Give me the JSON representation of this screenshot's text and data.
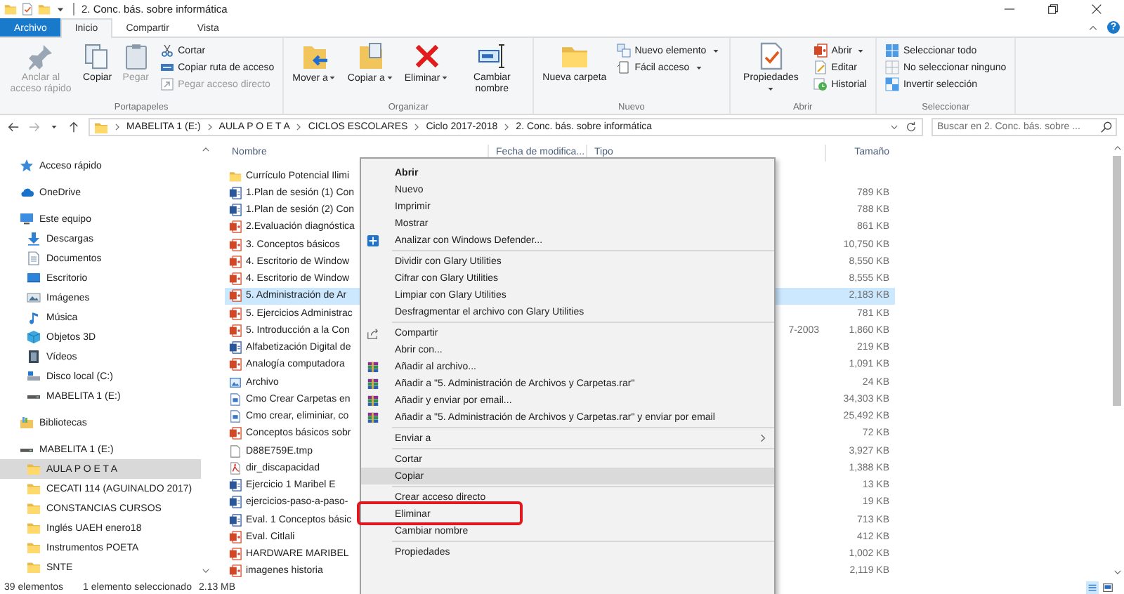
{
  "window": {
    "title": "2. Conc. bás. sobre informática",
    "help": "?"
  },
  "ribbon_tabs": [
    {
      "label": "Archivo",
      "kind": "file",
      "selected": false
    },
    {
      "label": "Inicio",
      "kind": "tab",
      "selected": true
    },
    {
      "label": "Compartir",
      "kind": "tab",
      "selected": false
    },
    {
      "label": "Vista",
      "kind": "tab",
      "selected": false
    }
  ],
  "ribbon_groups": [
    {
      "label": "Portapapeles",
      "large": [
        {
          "label": "Anclar al acceso rápido",
          "kind": "pin",
          "disabled": true,
          "dropdown": false
        },
        {
          "label": "Copiar",
          "kind": "copy",
          "disabled": false,
          "dropdown": false
        },
        {
          "label": "Pegar",
          "kind": "paste",
          "disabled": true,
          "dropdown": false
        }
      ],
      "small": [
        {
          "label": "Cortar",
          "kind": "cut",
          "disabled": false,
          "dropdown": false
        },
        {
          "label": "Copiar ruta de acceso",
          "kind": "path",
          "disabled": false,
          "dropdown": false
        },
        {
          "label": "Pegar acceso directo",
          "kind": "shortcut",
          "disabled": true,
          "dropdown": false
        }
      ]
    },
    {
      "label": "Organizar",
      "large": [
        {
          "label": "Mover a",
          "kind": "move",
          "disabled": false,
          "dropdown": true
        },
        {
          "label": "Copiar a",
          "kind": "copyto",
          "disabled": false,
          "dropdown": true
        },
        {
          "label": "Eliminar",
          "kind": "delete",
          "disabled": false,
          "dropdown": true
        },
        {
          "label": "Cambiar nombre",
          "kind": "rename",
          "disabled": false,
          "dropdown": false
        }
      ]
    },
    {
      "label": "Nuevo",
      "large": [
        {
          "label": "Nueva carpeta",
          "kind": "folder",
          "disabled": false,
          "dropdown": false
        }
      ],
      "small": [
        {
          "label": "Nuevo elemento",
          "kind": "newitem",
          "disabled": false,
          "dropdown": true
        },
        {
          "label": "Fácil acceso",
          "kind": "easy",
          "disabled": false,
          "dropdown": true
        }
      ]
    },
    {
      "label": "Abrir",
      "large": [
        {
          "label": "Propiedades",
          "kind": "properties",
          "disabled": false,
          "dropdown": true
        }
      ],
      "small": [
        {
          "label": "Abrir",
          "kind": "powerpoint",
          "disabled": false,
          "dropdown": true
        },
        {
          "label": "Editar",
          "kind": "edit",
          "disabled": false,
          "dropdown": false
        },
        {
          "label": "Historial",
          "kind": "history",
          "disabled": false,
          "dropdown": false
        }
      ]
    },
    {
      "label": "Seleccionar",
      "small": [
        {
          "label": "Seleccionar todo",
          "kind": "selectall",
          "disabled": false,
          "dropdown": false
        },
        {
          "label": "No seleccionar ninguno",
          "kind": "selectnone",
          "disabled": false,
          "dropdown": false
        },
        {
          "label": "Invertir selección",
          "kind": "invert",
          "disabled": false,
          "dropdown": false
        }
      ]
    }
  ],
  "address_bar": {
    "crumbs": [
      "MABELITA 1 (E:)",
      "AULA P O E T A",
      "CICLOS ESCOLARES",
      "Ciclo 2017-2018",
      "2. Conc. bás. sobre informática"
    ]
  },
  "search": {
    "placeholder": "Buscar en 2. Conc. bás. sobre ..."
  },
  "navigation": {
    "items": [
      {
        "label": "Acceso rápido",
        "kind": "star",
        "selected": false
      },
      {
        "label": "OneDrive",
        "kind": "cloud",
        "selected": false
      },
      {
        "label": "Este equipo",
        "kind": "computer",
        "selected": false,
        "children": [
          {
            "label": "Descargas",
            "kind": "download",
            "selected": false
          },
          {
            "label": "Documentos",
            "kind": "documents",
            "selected": false
          },
          {
            "label": "Escritorio",
            "kind": "desktop",
            "selected": false
          },
          {
            "label": "Imágenes",
            "kind": "images",
            "selected": false
          },
          {
            "label": "Música",
            "kind": "music",
            "selected": false
          },
          {
            "label": "Objetos 3D",
            "kind": "objects",
            "selected": false
          },
          {
            "label": "Vídeos",
            "kind": "videos",
            "selected": false
          },
          {
            "label": "Disco local (C:)",
            "kind": "disk",
            "selected": false
          },
          {
            "label": "MABELITA 1 (E:)",
            "kind": "usb",
            "selected": false
          }
        ]
      },
      {
        "label": "Bibliotecas",
        "kind": "library",
        "selected": false
      },
      {
        "label": "MABELITA 1 (E:)",
        "kind": "usb",
        "selected": false,
        "children": [
          {
            "label": "AULA P O E T A",
            "kind": "folder",
            "selected": true
          },
          {
            "label": "CECATI 114 (AGUINALDO 2017)",
            "kind": "folder",
            "selected": false
          },
          {
            "label": "CONSTANCIAS CURSOS",
            "kind": "folder",
            "selected": false
          },
          {
            "label": "Inglés UAEH enero18",
            "kind": "folder",
            "selected": false
          },
          {
            "label": "Instrumentos POETA",
            "kind": "folder",
            "selected": false
          },
          {
            "label": "SNTE",
            "kind": "folder",
            "selected": false
          }
        ]
      }
    ]
  },
  "file_list": {
    "columns": [
      "Nombre",
      "Fecha de modifica...",
      "Tipo",
      "Tamaño"
    ],
    "rows": [
      {
        "name": "Currículo Potencial Ilimi",
        "kind": "folder",
        "selected": false
      },
      {
        "name": "1.Plan de sesión (1) Con",
        "kind": "word",
        "size": "789 KB",
        "selected": false
      },
      {
        "name": "1.Plan de sesión (2) Con",
        "kind": "word",
        "size": "788 KB",
        "selected": false
      },
      {
        "name": "2.Evaluación diagnóstica",
        "kind": "powerpoint",
        "size": "861 KB",
        "selected": false
      },
      {
        "name": "3. Conceptos básicos",
        "kind": "powerpoint",
        "size": "10,750 KB",
        "selected": false
      },
      {
        "name": "4. Escritorio de Window",
        "kind": "powerpoint",
        "size": "8,550 KB",
        "selected": false
      },
      {
        "name": "4. Escritorio de Window",
        "kind": "powerpoint",
        "size": "8,555 KB",
        "selected": false
      },
      {
        "name": "5. Administración de Ar",
        "kind": "powerpoint",
        "size": "2,183 KB",
        "selected": true
      },
      {
        "name": "5. Ejercicios Administrac",
        "kind": "powerpoint",
        "size": "781 KB",
        "selected": false
      },
      {
        "name": "5. Introducción a  la Con",
        "kind": "powerpoint",
        "type": "7-2003",
        "size": "1,860 KB",
        "selected": false
      },
      {
        "name": "Alfabetización Digital de",
        "kind": "word",
        "size": "219 KB",
        "selected": false
      },
      {
        "name": "Analogía computadora",
        "kind": "powerpoint",
        "size": "1,091 KB",
        "selected": false
      },
      {
        "name": "Archivo",
        "kind": "image",
        "size": "24 KB",
        "selected": false
      },
      {
        "name": "Cmo Crear Carpetas en",
        "kind": "text",
        "size": "34,303 KB",
        "selected": false
      },
      {
        "name": "Cmo crear, eliminiar, co",
        "kind": "text",
        "size": "25,492 KB",
        "selected": false
      },
      {
        "name": "Conceptos básicos sobr",
        "kind": "powerpoint",
        "size": "72 KB",
        "selected": false
      },
      {
        "name": "D88E759E.tmp",
        "kind": "blank",
        "size": "3,927 KB",
        "selected": false
      },
      {
        "name": "dir_discapacidad",
        "kind": "pdf",
        "size": "1,388 KB",
        "selected": false
      },
      {
        "name": "Ejercicio 1 Maribel E",
        "kind": "word",
        "size": "13 KB",
        "selected": false
      },
      {
        "name": "ejercicios-paso-a-paso-",
        "kind": "word",
        "size": "19 KB",
        "selected": false
      },
      {
        "name": "Eval. 1 Conceptos básic",
        "kind": "word",
        "size": "713 KB",
        "selected": false
      },
      {
        "name": "Eval. Citlali",
        "kind": "powerpoint",
        "size": "412 KB",
        "selected": false
      },
      {
        "name": "HARDWARE MARIBEL",
        "kind": "powerpoint",
        "size": "1,002 KB",
        "selected": false
      },
      {
        "name": "imagenes historia",
        "kind": "powerpoint",
        "size": "2,119 KB",
        "selected": false
      }
    ]
  },
  "context_menu": {
    "items": [
      {
        "label": "Abrir",
        "kind": "plain",
        "default": true,
        "hovered": false,
        "submenu": false,
        "annotated": false
      },
      {
        "label": "Nuevo",
        "kind": "plain",
        "default": false,
        "hovered": false,
        "submenu": false,
        "annotated": false
      },
      {
        "label": "Imprimir",
        "kind": "plain",
        "default": false,
        "hovered": false,
        "submenu": false,
        "annotated": false
      },
      {
        "label": "Mostrar",
        "kind": "plain",
        "default": false,
        "hovered": false,
        "submenu": false,
        "annotated": false
      },
      {
        "label": "Analizar con Windows Defender...",
        "kind": "defender",
        "default": false,
        "hovered": false,
        "submenu": false,
        "annotated": false
      },
      {
        "kind": "separator"
      },
      {
        "label": "Dividir con Glary Utilities",
        "kind": "plain",
        "default": false,
        "hovered": false,
        "submenu": false,
        "annotated": false
      },
      {
        "label": "Cifrar con Glary Utilities",
        "kind": "plain",
        "default": false,
        "hovered": false,
        "submenu": false,
        "annotated": false
      },
      {
        "label": "Limpiar con Glary Utilities",
        "kind": "plain",
        "default": false,
        "hovered": false,
        "submenu": false,
        "annotated": false
      },
      {
        "label": "Desfragmentar el archivo con Glary Utilities",
        "kind": "plain",
        "default": false,
        "hovered": false,
        "submenu": false,
        "annotated": false
      },
      {
        "kind": "separator"
      },
      {
        "label": "Compartir",
        "kind": "share",
        "default": false,
        "hovered": false,
        "submenu": false,
        "annotated": false
      },
      {
        "label": "Abrir con...",
        "kind": "plain",
        "default": false,
        "hovered": false,
        "submenu": false,
        "annotated": false
      },
      {
        "label": "Añadir al archivo...",
        "kind": "archive",
        "default": false,
        "hovered": false,
        "submenu": false,
        "annotated": false
      },
      {
        "label": "Añadir a \"5. Administración de Archivos y Carpetas.rar\"",
        "kind": "archive",
        "default": false,
        "hovered": false,
        "submenu": false,
        "annotated": false
      },
      {
        "label": "Añadir y enviar por email...",
        "kind": "archive",
        "default": false,
        "hovered": false,
        "submenu": false,
        "annotated": false
      },
      {
        "label": "Añadir a \"5. Administración de Archivos y Carpetas.rar\" y enviar por email",
        "kind": "archive",
        "default": false,
        "hovered": false,
        "submenu": false,
        "annotated": false
      },
      {
        "kind": "separator"
      },
      {
        "label": "Enviar a",
        "kind": "plain",
        "default": false,
        "hovered": false,
        "submenu": true,
        "annotated": false
      },
      {
        "kind": "separator"
      },
      {
        "label": "Cortar",
        "kind": "plain",
        "default": false,
        "hovered": false,
        "submenu": false,
        "annotated": false
      },
      {
        "label": "Copiar",
        "kind": "plain",
        "default": false,
        "hovered": true,
        "submenu": false,
        "annotated": false
      },
      {
        "kind": "separator"
      },
      {
        "label": "Crear acceso directo",
        "kind": "plain",
        "default": false,
        "hovered": false,
        "submenu": false,
        "annotated": false
      },
      {
        "label": "Eliminar",
        "kind": "plain",
        "default": false,
        "hovered": false,
        "submenu": false,
        "annotated": true
      },
      {
        "label": "Cambiar nombre",
        "kind": "plain",
        "default": false,
        "hovered": false,
        "submenu": false,
        "annotated": false
      },
      {
        "kind": "separator"
      },
      {
        "label": "Propiedades",
        "kind": "plain",
        "default": false,
        "hovered": false,
        "submenu": false,
        "annotated": false
      }
    ]
  },
  "status_bar": {
    "count": "39 elementos",
    "selection": "1 elemento seleccionado",
    "size": "2.13 MB"
  }
}
